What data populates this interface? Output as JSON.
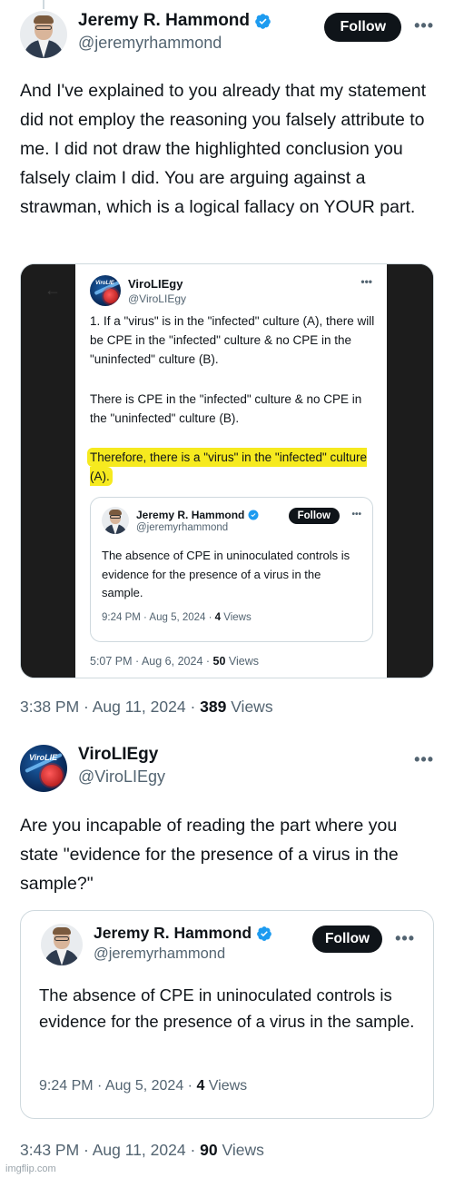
{
  "colors": {
    "verified": "#1d9bf0",
    "highlight": "#f6ea1f",
    "follow_bg": "#0f1419"
  },
  "tweet1": {
    "name": "Jeremy R. Hammond",
    "handle": "@jeremyrhammond",
    "follow": "Follow",
    "more": "•••",
    "text": "And I've explained to you already that my statement did not employ the reasoning you falsely attribute to me. I did not draw the highlighted conclusion you falsely claim I did. You are arguing against a strawman, which is a logical fallacy on YOUR part.",
    "time": "3:38 PM · Aug 11, 2024 · ",
    "views_count": "389",
    "views_label": " Views"
  },
  "screenshot": {
    "name": "ViroLIEgy",
    "handle": "@ViroLIEgy",
    "more": "•••",
    "para1": "1. If a \"virus\" is in the \"infected\" culture (A), there will be CPE in the \"infected\" culture & no CPE in the \"uninfected\" culture (B).",
    "para2": "There is CPE in the \"infected\" culture & no CPE in the \"uninfected\" culture (B).",
    "para3": "Therefore, there is a \"virus\" in the \"infected\" culture (A).",
    "quote": {
      "name": "Jeremy R. Hammond",
      "handle": "@jeremyrhammond",
      "follow": "Follow",
      "more": "•••",
      "text": "The absence of CPE in uninoculated controls is evidence for the presence of a virus in the sample.",
      "time": "9:24 PM · Aug 5, 2024 · ",
      "views_count": "4",
      "views_label": " Views"
    },
    "time": "5:07 PM · Aug 6, 2024 · ",
    "views_count": "50",
    "views_label": " Views"
  },
  "tweet2": {
    "name": "ViroLIEgy",
    "handle": "@ViroLIEgy",
    "more": "•••",
    "text": "Are you incapable of reading the part where you state \"evidence for the presence of a virus in the sample?\"",
    "quote": {
      "name": "Jeremy R. Hammond",
      "handle": "@jeremyrhammond",
      "follow": "Follow",
      "more": "•••",
      "text": "The absence of CPE in uninoculated controls is evidence for the presence of a virus in the sample.",
      "time": "9:24 PM · Aug 5, 2024 · ",
      "views_count": "4",
      "views_label": " Views"
    },
    "time": "3:43 PM · Aug 11, 2024 · ",
    "views_count": "90",
    "views_label": " Views"
  },
  "watermark": "imgflip.com"
}
